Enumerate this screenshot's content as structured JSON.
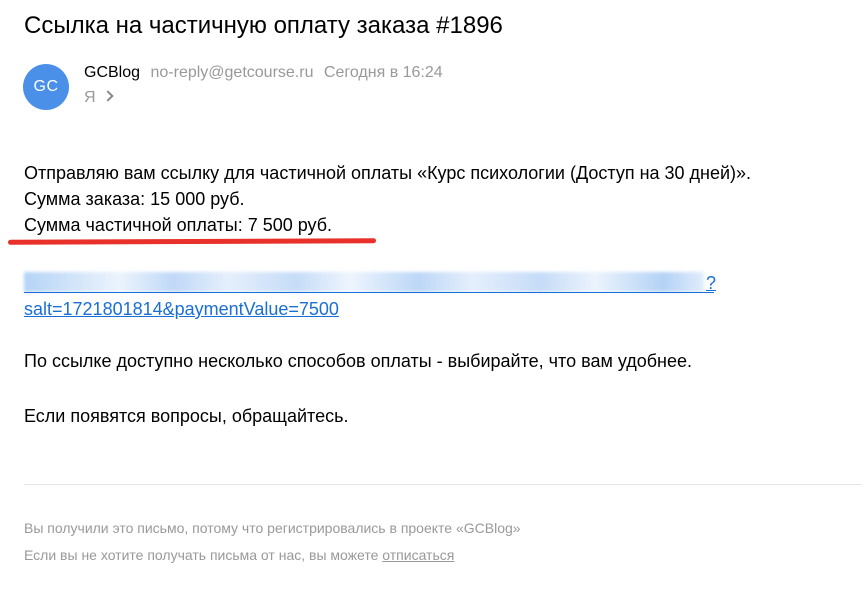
{
  "email": {
    "subject": "Ссылка на частичную оплату заказа #1896",
    "sender": {
      "avatar_initials": "GC",
      "avatar_color": "#4a8fe8",
      "name": "GCBlog",
      "email": "no-reply@getcourse.ru",
      "time": "Сегодня в 16:24"
    },
    "recipient": "Я",
    "body": {
      "line1": "Отправляю вам ссылку для частичной оплаты «Курс психологии (Доступ на 30 дней)».",
      "line2": "Сумма заказа: 15 000 руб.",
      "line3": "Сумма частичной оплаты: 7 500 руб.",
      "link_qmark": "?",
      "link_line2": "salt=1721801814&paymentValue=7500",
      "para2": "По ссылке доступно несколько способов оплаты - выбирайте, что вам удобнее.",
      "para3": "Если появятся вопросы, обращайтесь."
    },
    "footer": {
      "line1": "Вы получили это письмо, потому что регистрировались в проекте «GCBlog»",
      "line2_prefix": "Если вы не хотите получать письма от нас, вы можете ",
      "unsubscribe_label": "отписаться"
    }
  },
  "colors": {
    "highlight_underline": "#e8312a",
    "link": "#1a6fd6"
  }
}
